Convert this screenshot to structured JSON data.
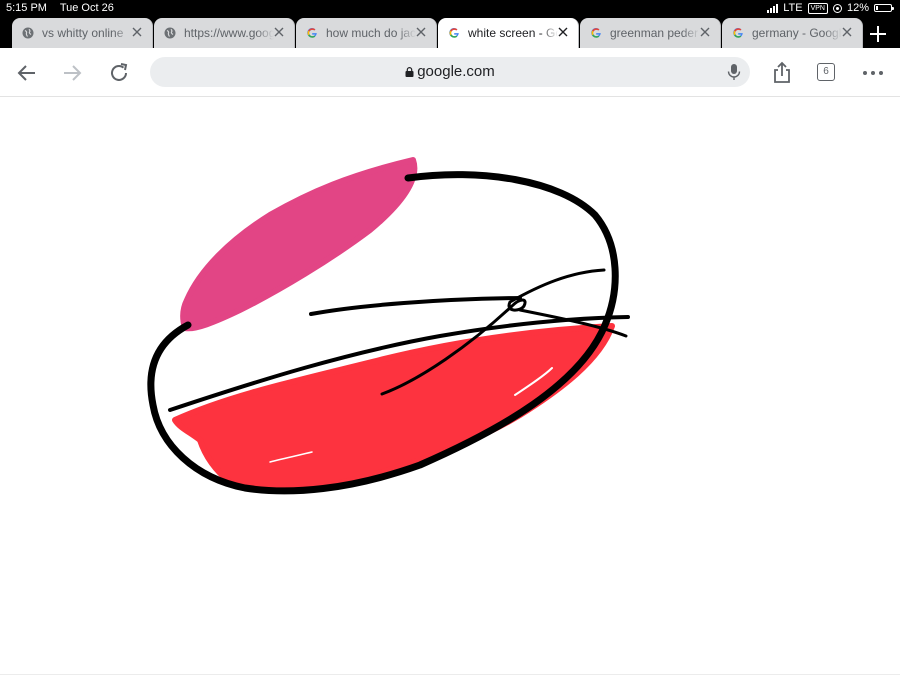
{
  "status_bar": {
    "time": "5:15 PM",
    "date": "Tue Oct 26",
    "network": "LTE",
    "vpn": "VPN",
    "battery": "12%",
    "battery_level": 0.12
  },
  "tabs": [
    {
      "title": "vs whitty online",
      "favicon": "globe-icon",
      "active": false
    },
    {
      "title": "https://www.google.com",
      "favicon": "globe-icon",
      "active": false
    },
    {
      "title": "how much do jacks",
      "favicon": "google-icon",
      "active": false
    },
    {
      "title": "white screen - Google",
      "favicon": "google-icon",
      "active": true
    },
    {
      "title": "greenman peder",
      "favicon": "google-icon",
      "active": false
    },
    {
      "title": "germany - Google",
      "favicon": "google-icon",
      "active": false
    }
  ],
  "toolbar": {
    "url": "google.com",
    "tab_count": "6"
  },
  "colors": {
    "pink": "#e24585",
    "red": "#fd333f",
    "ink": "#000000"
  }
}
